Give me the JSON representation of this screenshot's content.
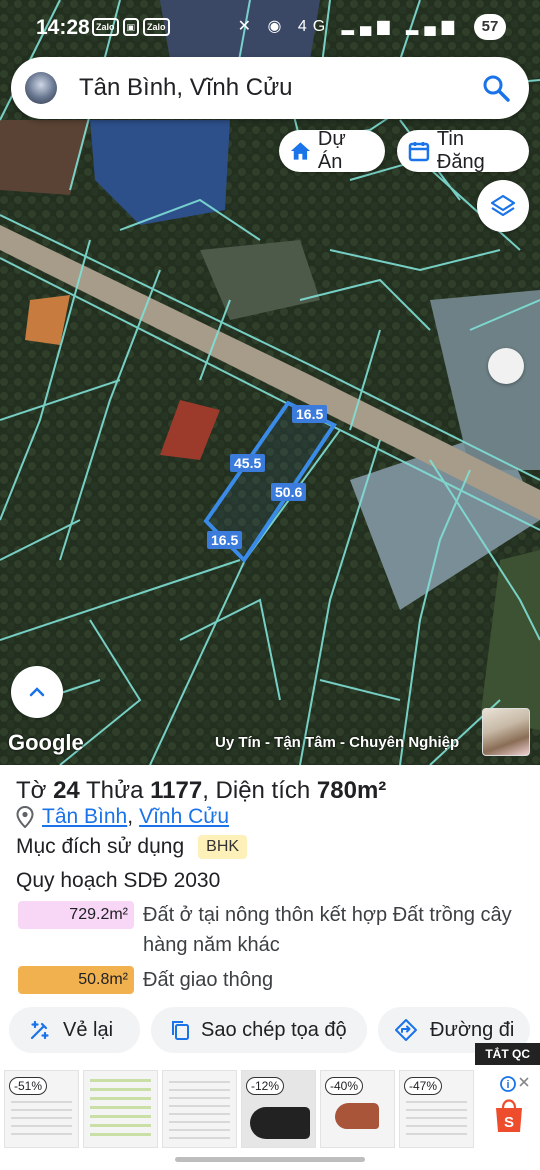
{
  "status_bar": {
    "time": "14:28",
    "app_icons": [
      "Zalo",
      "▣",
      "Zalo"
    ],
    "system_icons": "✕ ◉ 4G ▂▄▆ ▂▄▆",
    "battery": "57"
  },
  "search": {
    "query": "Tân Bình, Vĩnh Cửu"
  },
  "chips": {
    "du_an": "Dự Án",
    "tin_dang": "Tin Đăng"
  },
  "map": {
    "segments": [
      "16.5",
      "45.5",
      "50.6",
      "16.5"
    ],
    "google_label": "Google",
    "slogan": "Uy Tín - Tận Tâm - Chuyên Nghiệp",
    "colors": {
      "parcel_line": "#7fe0d6",
      "selected_line": "#3a8be8",
      "segment_label": "#3a7bdb"
    }
  },
  "parcel": {
    "sheet_label": "Tờ",
    "sheet_no": "24",
    "plot_label": "Thửa",
    "plot_no": "1177",
    "area_label": ", Diện tích",
    "area_value": "780m²",
    "ward": "Tân Bình",
    "separator": ",",
    "district": "Vĩnh Cửu",
    "purpose_label": "Mục đích sử dụng",
    "purpose_code": "BHK",
    "plan_label": "Quy hoạch SDĐ 2030",
    "zones": [
      {
        "area": "729.2m²",
        "desc": "Đất ở tại nông thôn kết hợp Đất trồng cây hàng năm khác",
        "color": "#f7d6f6"
      },
      {
        "area": "50.8m²",
        "desc": "Đất giao thông",
        "color": "#f2b14f"
      }
    ]
  },
  "actions": {
    "draw": "Vẻ lại",
    "copy": "Sao chép tọa độ",
    "route": "Đường đi"
  },
  "ad": {
    "close_label": "TẮT QC",
    "badges": [
      "-51%",
      "",
      "",
      "-12%",
      "-40%",
      "-47%"
    ]
  }
}
